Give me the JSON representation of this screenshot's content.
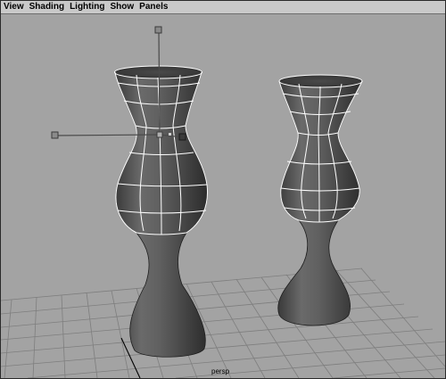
{
  "menubar": {
    "items": [
      {
        "label": "View"
      },
      {
        "label": "Shading"
      },
      {
        "label": "Lighting"
      },
      {
        "label": "Show"
      },
      {
        "label": "Panels"
      }
    ]
  },
  "viewport": {
    "camera_label": "persp",
    "background_color": "#a3a3a3",
    "object_color": "#575757",
    "wireframe_color": "#ffffff",
    "grid_color": "#7e7e7e"
  }
}
